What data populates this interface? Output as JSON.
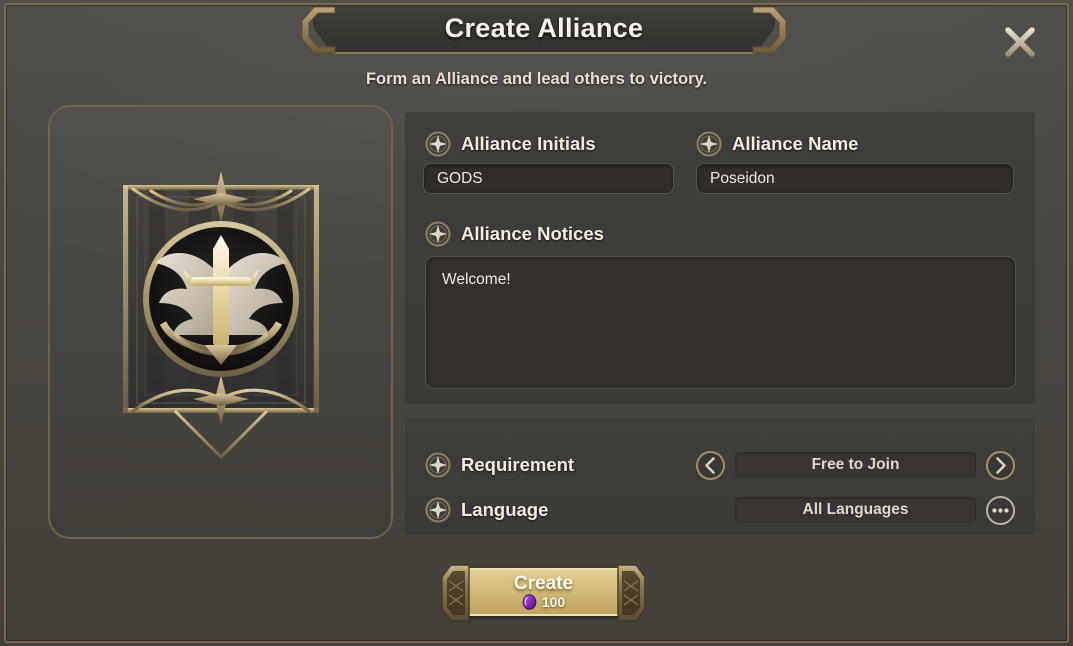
{
  "dialog": {
    "title": "Create Alliance",
    "subtitle": "Form an Alliance and lead others to victory.",
    "close_icon": "close-icon"
  },
  "emblem": {
    "icon_name": "alliance-banner-emblem",
    "crest_name": "winged-sword-crest"
  },
  "form": {
    "initials": {
      "label": "Alliance Initials",
      "value": "GODS",
      "placeholder": "Alliance Initials",
      "bullet_icon": "star-bullet-icon"
    },
    "name": {
      "label": "Alliance Name",
      "value": "Poseidon",
      "placeholder": "Alliance Name",
      "bullet_icon": "star-bullet-icon"
    },
    "notices": {
      "label": "Alliance Notices",
      "value": "Welcome!",
      "placeholder": "Alliance Notices",
      "bullet_icon": "star-bullet-icon"
    }
  },
  "options": {
    "requirement": {
      "label": "Requirement",
      "value": "Free to Join",
      "bullet_icon": "star-bullet-icon",
      "prev_icon": "chevron-left-icon",
      "next_icon": "chevron-right-icon"
    },
    "language": {
      "label": "Language",
      "value": "All Languages",
      "bullet_icon": "star-bullet-icon",
      "more_icon": "ellipsis-icon"
    }
  },
  "create_button": {
    "label": "Create",
    "cost": "100",
    "cost_icon": "gem-icon"
  },
  "colors": {
    "accent_gold": "#c9ad6e",
    "bronze_border": "#7a6a50",
    "panel_bg": "#3e3c38",
    "dialog_bg": "#484640",
    "text_primary": "#f2ece1",
    "gem_purple": "#7b2fb5"
  }
}
